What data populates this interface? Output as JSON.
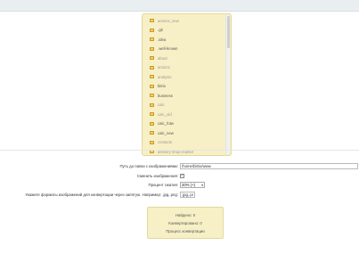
{
  "folder_tree": {
    "items": [
      {
        "label": "actions_new",
        "dim": true
      },
      {
        "label": ".git",
        "dim": false
      },
      {
        "label": ".idea",
        "dim": false
      },
      {
        "label": ".well-known",
        "dim": false
      },
      {
        "label": "about",
        "dim": true
      },
      {
        "label": "actions",
        "dim": true
      },
      {
        "label": "analysis",
        "dim": true
      },
      {
        "label": "bitrix",
        "dim": false
      },
      {
        "label": "business",
        "dim": false
      },
      {
        "label": "calc",
        "dim": true
      },
      {
        "label": "calc_old",
        "dim": true
      },
      {
        "label": "calc_fotw",
        "dim": false
      },
      {
        "label": "calc_new",
        "dim": false
      },
      {
        "label": "contacts",
        "dim": true
      },
      {
        "label": "delivery-shop-market",
        "dim": true
      }
    ]
  },
  "form": {
    "path_label": "Путь до папки с изображениями:",
    "path_value": "/home/bitrix/www",
    "replace_label": "Сменить изображения:",
    "replace_checked": "✓",
    "quality_label": "Процент сжатия:",
    "quality_value": "20% (+)",
    "formats_label": "Укажите форматы изображений для конвертации через запятую. Например: .jpg,.png:",
    "formats_value": ".jpg,.png"
  },
  "status": {
    "found": "Найдено: 0",
    "converted": "Конвертировано: 0",
    "progress": "Процесс конвертации"
  }
}
